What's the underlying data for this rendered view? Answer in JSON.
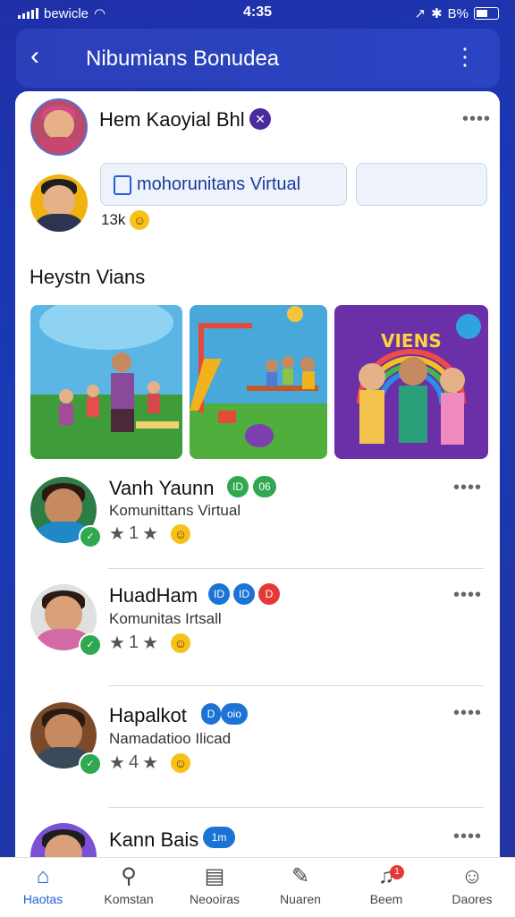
{
  "status": {
    "carrier": "bewicle",
    "time": "4:35",
    "battery": "B%"
  },
  "header": {
    "title": "Nibumians Bonudea"
  },
  "post": {
    "author": "Hem Kaoyial Bhl",
    "community_label": "mohorunitans Virtual",
    "reactions": "13k"
  },
  "section": {
    "title": "Heystn Vians"
  },
  "gallery": {
    "banner_text": "VIENS"
  },
  "users": [
    {
      "name": "Vanh Yaunn",
      "sub": "Komunittans Virtual",
      "rating": "1",
      "badges": [
        "ID",
        "06"
      ]
    },
    {
      "name": "HuadHam",
      "sub": "Komunitas Irtsall",
      "rating": "1",
      "badges": [
        "ID",
        "ID",
        "D"
      ]
    },
    {
      "name": "Hapalkot",
      "sub": "Namadatioo Ilicad",
      "rating": "4",
      "badges": [
        "D",
        "oio"
      ]
    },
    {
      "name": "Kann Bais",
      "sub": "",
      "rating": "",
      "badges": [
        "1m"
      ]
    }
  ],
  "nav": [
    {
      "label": "Haotas",
      "icon": "home-icon",
      "active": true
    },
    {
      "label": "Komstan",
      "icon": "search-icon"
    },
    {
      "label": "Neooiras",
      "icon": "list-icon"
    },
    {
      "label": "Nuaren",
      "icon": "edit-icon"
    },
    {
      "label": "Beem",
      "icon": "bell-icon",
      "badge": "1"
    },
    {
      "label": "Daores",
      "icon": "profile-icon"
    }
  ],
  "colors": {
    "accent": "#1b63d6",
    "header": "#2a44c2",
    "online": "#2fa84f"
  }
}
